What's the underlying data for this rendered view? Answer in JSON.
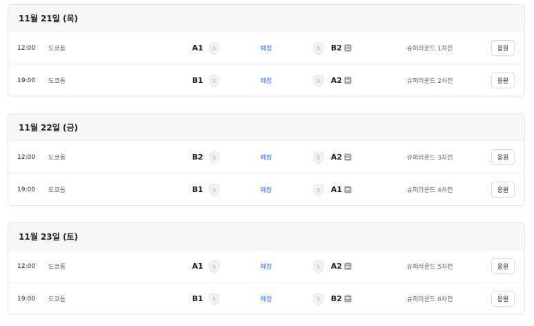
{
  "days": [
    {
      "date_label": "11월 21일 (목)",
      "matches": [
        {
          "time": "12:00",
          "venue": "도쿄돔",
          "home": "A1",
          "status": "예정",
          "away": "B2",
          "round": "슈퍼라운드 1차전",
          "button": "응원"
        },
        {
          "time": "19:00",
          "venue": "도쿄돔",
          "home": "B1",
          "status": "예정",
          "away": "A2",
          "round": "슈퍼라운드 2차전",
          "button": "응원"
        }
      ]
    },
    {
      "date_label": "11월 22일 (금)",
      "matches": [
        {
          "time": "12:00",
          "venue": "도쿄돔",
          "home": "B2",
          "status": "예정",
          "away": "A2",
          "round": "슈퍼라운드 3차전",
          "button": "응원"
        },
        {
          "time": "19:00",
          "venue": "도쿄돔",
          "home": "B1",
          "status": "예정",
          "away": "A1",
          "round": "슈퍼라운드 4차전",
          "button": "응원"
        }
      ]
    },
    {
      "date_label": "11월 23일 (토)",
      "matches": [
        {
          "time": "12:00",
          "venue": "도쿄돔",
          "home": "A1",
          "status": "예정",
          "away": "A2",
          "round": "슈퍼라운드 5차전",
          "button": "응원"
        },
        {
          "time": "19:00",
          "venue": "도쿄돔",
          "home": "B1",
          "status": "예정",
          "away": "B2",
          "round": "슈퍼라운드 6차전",
          "button": "응원"
        }
      ]
    }
  ],
  "icons": {
    "team_emblem": "shield-icon",
    "broadcast": "tv-icon"
  },
  "colors": {
    "status": "#2f6ee6",
    "header_bg": "#f7f7f8",
    "border": "#e6e6e6"
  }
}
